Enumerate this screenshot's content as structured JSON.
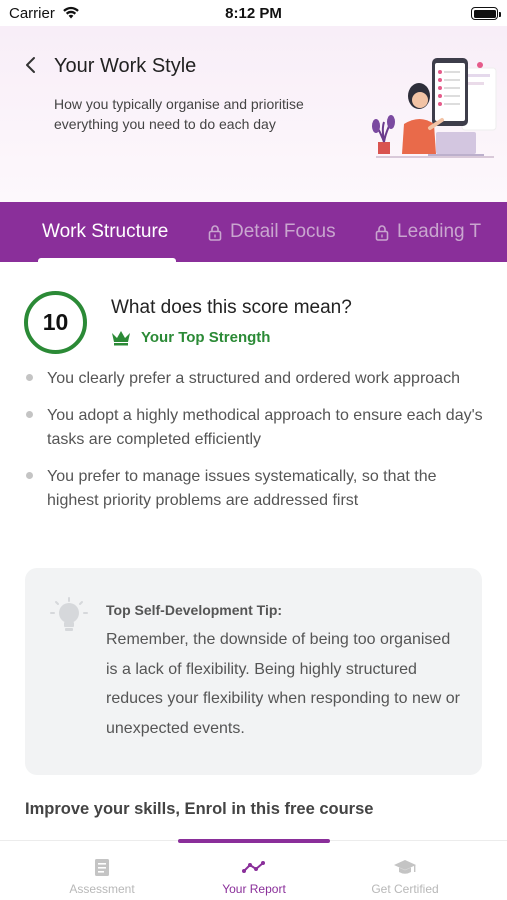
{
  "status_bar": {
    "carrier": "Carrier",
    "time": "8:12 PM"
  },
  "header": {
    "title": "Your Work Style",
    "subtitle": "How you typically organise and prioritise everything you need to do each day"
  },
  "tabs": [
    {
      "label": "Work Structure",
      "locked": false,
      "active": true
    },
    {
      "label": "Detail Focus",
      "locked": true,
      "active": false
    },
    {
      "label": "Leading T",
      "locked": true,
      "active": false
    }
  ],
  "score": {
    "value": "10",
    "question": "What does this score mean?",
    "strength_label": "Your Top Strength"
  },
  "bullets": [
    "You clearly prefer a structured and ordered work approach",
    "You adopt a highly methodical approach to ensure each day's tasks are completed efficiently",
    "You prefer to manage issues systematically, so that the highest priority problems are addressed first"
  ],
  "tip": {
    "title": "Top Self-Development Tip:",
    "body": "Remember, the downside of being too organised is a lack of flexibility. Being highly structured reduces your flexibility when responding to new or unexpected events."
  },
  "course_prompt": "Improve your skills, Enrol in this free course",
  "bottom_nav": [
    {
      "label": "Assessment",
      "icon": "document-icon",
      "active": false
    },
    {
      "label": "Your Report",
      "icon": "chart-line-icon",
      "active": true
    },
    {
      "label": "Get Certified",
      "icon": "graduation-cap-icon",
      "active": false
    }
  ],
  "colors": {
    "brand_purple": "#8a2f9a",
    "strength_green": "#2b8a36",
    "tab_inactive": "#c9a6cf"
  }
}
